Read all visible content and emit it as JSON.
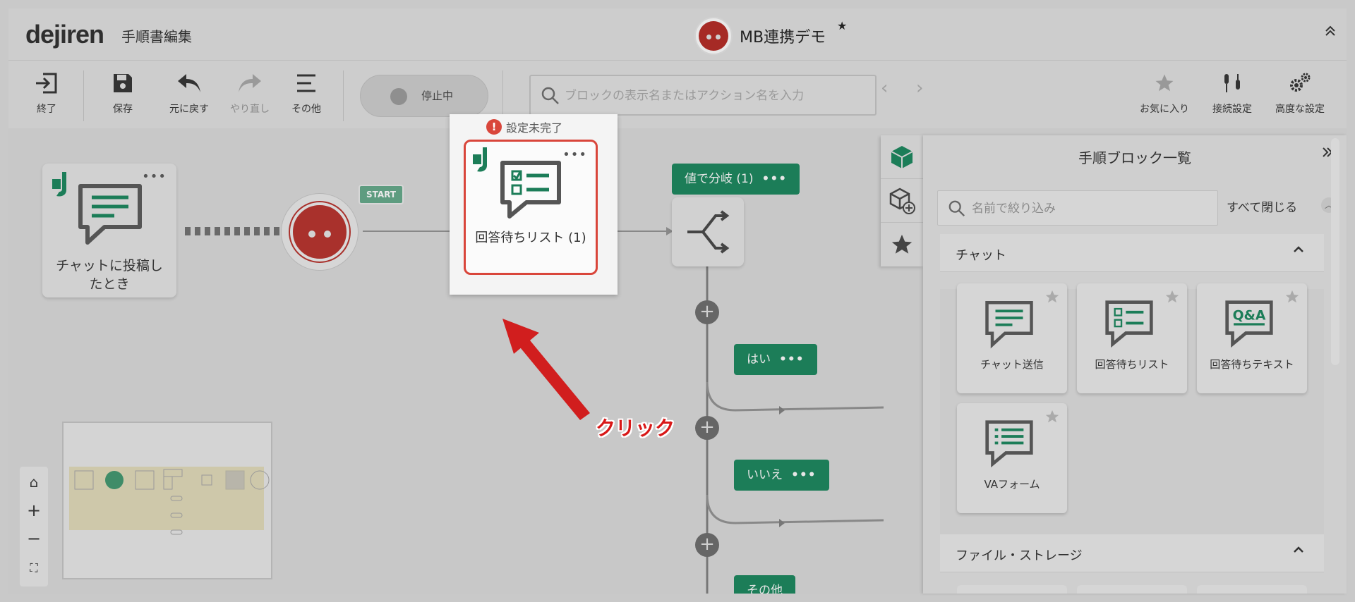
{
  "header": {
    "logo": "dejiren",
    "page_title": "手順書編集",
    "procedure_name": "MB連携デモ",
    "unsaved_mark": "★",
    "collapse_icon": "chevron-up-icon"
  },
  "toolbar": {
    "exit_label": "終了",
    "save_label": "保存",
    "undo_label": "元に戻す",
    "redo_label": "やり直し",
    "more_label": "その他",
    "status_label": "停止中",
    "search_placeholder": "ブロックの表示名またはアクション名を入力",
    "favorites_label": "お気に入り",
    "connection_label": "接続設定",
    "advanced_label": "高度な設定"
  },
  "canvas": {
    "trigger_node_label": "チャットに投稿したとき",
    "start_tag": "START",
    "warning_text": "設定未完了",
    "selected_node_label": "回答待ちリスト (1)",
    "branch_node_tag": "値で分岐 (1)",
    "branch_yes": "はい",
    "branch_no": "いいえ",
    "branch_other": "その他",
    "more_dots": "•••",
    "plus": "+",
    "annotation_text": "クリック"
  },
  "zoom": {
    "home": "⌂",
    "zoom_in": "+",
    "zoom_out": "−",
    "fit": "⛶"
  },
  "side_panel": {
    "title": "手順ブロック一覧",
    "close_icon": "double-chevron-right-icon",
    "filter_placeholder": "名前で絞り込み",
    "collapse_all": "すべて閉じる",
    "sections": [
      {
        "title": "チャット",
        "items": [
          "チャット送信",
          "回答待ちリスト",
          "回答待ちテキスト",
          "VAフォーム"
        ]
      },
      {
        "title": "ファイル・ストレージ"
      }
    ]
  },
  "colors": {
    "brand_green": "#1c7d58",
    "alert_red": "#d9463b",
    "start_red": "#a9312c"
  }
}
